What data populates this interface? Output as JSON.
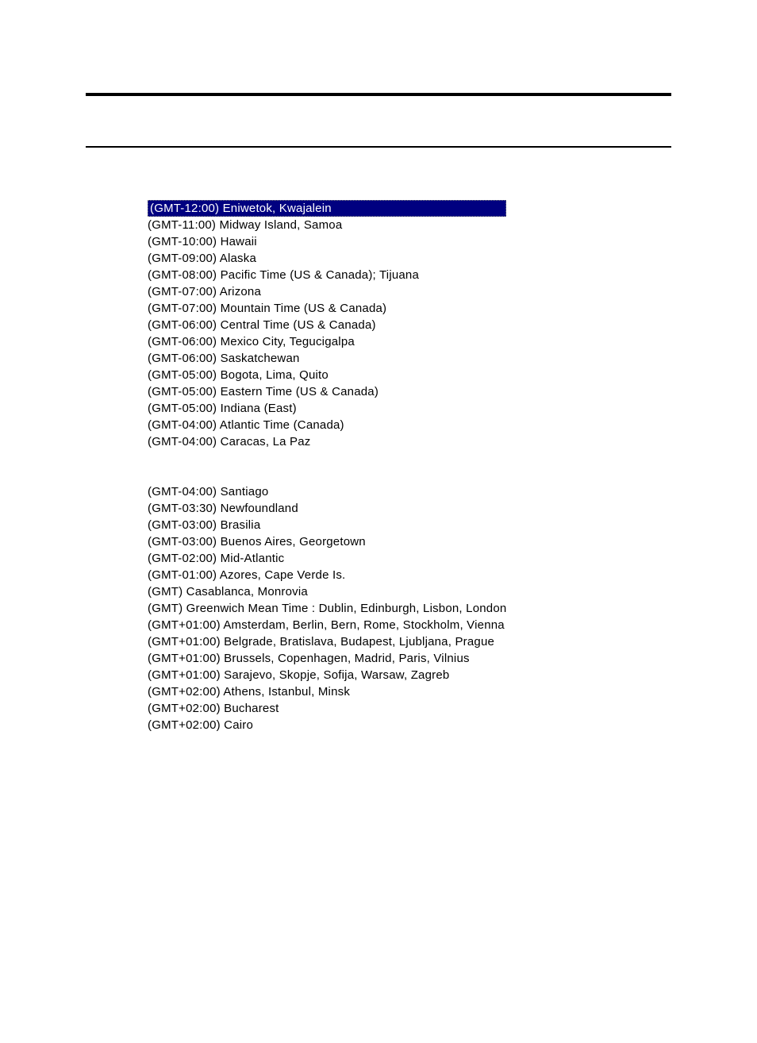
{
  "timezone_list": {
    "selected_index": 0,
    "group1": [
      "(GMT-12:00) Eniwetok, Kwajalein",
      "(GMT-11:00) Midway Island, Samoa",
      "(GMT-10:00) Hawaii",
      "(GMT-09:00) Alaska",
      "(GMT-08:00) Pacific Time (US & Canada); Tijuana",
      "(GMT-07:00) Arizona",
      "(GMT-07:00) Mountain Time (US & Canada)",
      "(GMT-06:00) Central Time (US & Canada)",
      "(GMT-06:00) Mexico City, Tegucigalpa",
      "(GMT-06:00) Saskatchewan",
      "(GMT-05:00) Bogota, Lima, Quito",
      "(GMT-05:00) Eastern Time (US & Canada)",
      "(GMT-05:00) Indiana (East)",
      "(GMT-04:00) Atlantic Time (Canada)",
      "(GMT-04:00) Caracas, La Paz"
    ],
    "group2": [
      "(GMT-04:00) Santiago",
      "(GMT-03:30) Newfoundland",
      "(GMT-03:00) Brasilia",
      "(GMT-03:00) Buenos Aires, Georgetown",
      "(GMT-02:00) Mid-Atlantic",
      "(GMT-01:00) Azores, Cape Verde Is.",
      "(GMT) Casablanca, Monrovia",
      "(GMT) Greenwich Mean Time : Dublin, Edinburgh, Lisbon, London",
      "(GMT+01:00) Amsterdam, Berlin, Bern, Rome, Stockholm, Vienna",
      "(GMT+01:00) Belgrade, Bratislava, Budapest, Ljubljana, Prague",
      "(GMT+01:00) Brussels, Copenhagen, Madrid, Paris, Vilnius",
      "(GMT+01:00) Sarajevo, Skopje, Sofija, Warsaw, Zagreb",
      "(GMT+02:00) Athens, Istanbul, Minsk",
      "(GMT+02:00) Bucharest",
      "(GMT+02:00) Cairo"
    ]
  }
}
